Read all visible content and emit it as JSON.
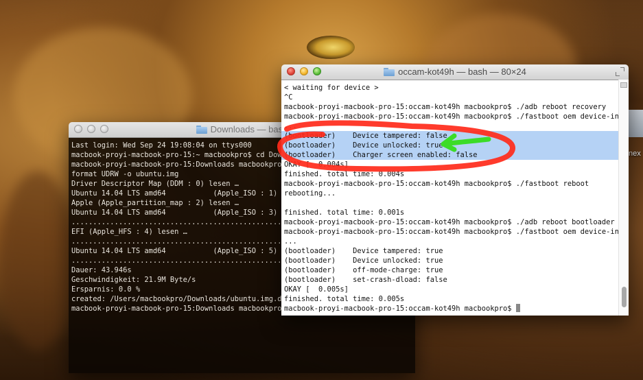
{
  "desktop": {
    "file_label": "nex"
  },
  "downloads_window": {
    "title": "Downloads — bash",
    "lines": [
      "Last login: Wed Sep 24 19:08:04 on ttys000",
      "macbook-proyi-macbook-pro-15:~ macbookpro$ cd Dow",
      "macbook-proyi-macbook-pro-15:Downloads macbookpro$",
      "format UDRW -o ubuntu.img",
      "Driver Descriptor Map (DDM : 0) lesen …",
      "Ubuntu 14.04 LTS amd64           (Apple_ISO : 1) le",
      "Apple (Apple_partition_map : 2) lesen …",
      "Ubuntu 14.04 LTS amd64           (Apple_ISO : 3) le",
      "......................................................",
      "EFI (Apple_HFS : 4) lesen …",
      "......................................................",
      "Ubuntu 14.04 LTS amd64           (Apple_ISO : 5) le",
      "......................................................",
      "Dauer: 43.946s",
      "Geschwindigkeit: 21.9M Byte/s",
      "Ersparnis: 0.0 %",
      "created: /Users/macbookpro/Downloads/ubuntu.img.dmg",
      "macbook-proyi-macbook-pro-15:Downloads macbookpro$"
    ]
  },
  "kot_window": {
    "title": "occam-kot49h — bash — 80×24",
    "lines": [
      "< waiting for device >",
      "^C",
      "macbook-proyi-macbook-pro-15:occam-kot49h macbookpro$ ./adb reboot recovery",
      "macbook-proyi-macbook-pro-15:occam-kot49h macbookpro$ ./fastboot oem device-info",
      "...",
      "(bootloader)    Device tampered: false",
      "(bootloader)    Device unlocked: true",
      "(bootloader)    Charger screen enabled: false",
      "OKAY [  0.004s]",
      "finished. total time: 0.004s",
      "macbook-proyi-macbook-pro-15:occam-kot49h macbookpro$ ./fastboot reboot",
      "rebooting...",
      "",
      "finished. total time: 0.001s",
      "macbook-proyi-macbook-pro-15:occam-kot49h macbookpro$ ./adb reboot bootloader",
      "macbook-proyi-macbook-pro-15:occam-kot49h macbookpro$ ./fastboot oem device-info",
      "...",
      "(bootloader)    Device tampered: true",
      "(bootloader)    Device unlocked: true",
      "(bootloader)    off-mode-charge: true",
      "(bootloader)    set-crash-dload: false",
      "OKAY [  0.005s]",
      "finished. total time: 0.005s",
      "macbook-proyi-macbook-pro-15:occam-kot49h macbookpro$ "
    ],
    "highlight_color": "#b5d2f5"
  },
  "annotation": {
    "circle_color": "#ff2a1a",
    "arrow_color": "#3cdc28"
  }
}
